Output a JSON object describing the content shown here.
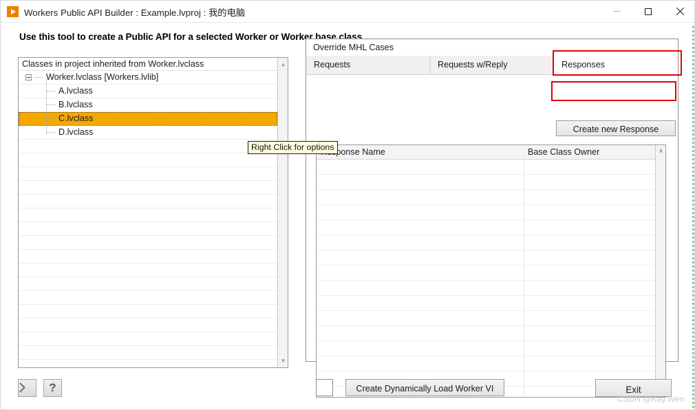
{
  "window": {
    "title": "Workers Public API Builder : Example.lvproj : 我的电脑",
    "app_icon": "labview-run-icon",
    "minimize_label": "–",
    "maximize_label": "□",
    "close_label": "✕"
  },
  "heading": "Use this tool to create a Public API for a selected Worker or Worker base class",
  "tree": {
    "header": "Classes in project inherited from Worker.lvclass",
    "rows": [
      {
        "label": "Worker.lvclass  [Workers.lvlib]",
        "depth": 0,
        "selected": false,
        "expander": true
      },
      {
        "label": "A.lvclass",
        "depth": 1,
        "selected": false,
        "expander": false
      },
      {
        "label": "B.lvclass",
        "depth": 1,
        "selected": false,
        "expander": false
      },
      {
        "label": "C.lvclass",
        "depth": 1,
        "selected": true,
        "expander": false
      },
      {
        "label": "D.lvclass",
        "depth": 1,
        "selected": false,
        "expander": false
      }
    ],
    "empty_row_count": 16,
    "scroll_up": "▲",
    "scroll_down": "▼"
  },
  "tooltip": "Right Click for options",
  "right_panel": {
    "caption": "Override MHL Cases",
    "tabs": [
      {
        "label": "Requests",
        "active": false
      },
      {
        "label": "Requests w/Reply",
        "active": false
      },
      {
        "label": "Responses",
        "active": true
      }
    ],
    "create_button": "Create new Response",
    "list": {
      "columns": [
        "Response Name",
        "Base Class Owner"
      ],
      "rows": [],
      "empty_row_count": 16,
      "scroll_up": "∧",
      "scroll_down": "∨"
    }
  },
  "bottom": {
    "back_button": "back-chevron",
    "help_button": "?",
    "dynamic_checkbox_checked": false,
    "dynamic_button": "Create Dynamically Load Worker VI",
    "exit_button": "Exit"
  },
  "watermark": "CSDN @Kay.Wen",
  "colors": {
    "selection_orange": "#f5a800",
    "annotation_red": "#e50000",
    "tooltip_yellow": "#ffffdd",
    "app_icon_orange": "#f07d00"
  }
}
